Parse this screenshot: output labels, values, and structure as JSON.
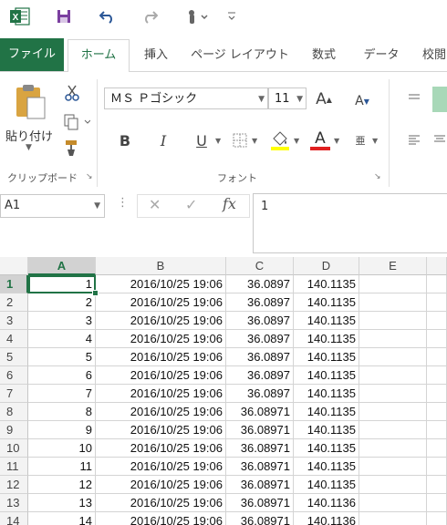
{
  "qat": {
    "excel_icon": "excel-icon",
    "save_icon": "save-icon",
    "undo_icon": "undo-icon",
    "redo_icon": "redo-icon",
    "touch_icon": "touch-mode-icon",
    "customize_icon": "customize-qat-icon"
  },
  "tabs": [
    "ファイル",
    "ホーム",
    "挿入",
    "ページ レイアウト",
    "数式",
    "データ",
    "校閲"
  ],
  "ribbon": {
    "paste_label": "貼り付け",
    "clipboard_group": "クリップボード",
    "font_group": "フォント",
    "font_name": "ＭＳ Ｐゴシック",
    "font_size": "11",
    "bold": "B",
    "italic": "I",
    "underline": "U",
    "font_color_letter": "A",
    "grow_font": "A",
    "shrink_font": "A",
    "phonetic": "亜",
    "fx": "fx"
  },
  "formula_bar": {
    "name_box": "A1",
    "formula": "1"
  },
  "grid": {
    "columns": [
      "A",
      "B",
      "C",
      "D",
      "E"
    ],
    "rows": [
      {
        "n": "1",
        "a": "1",
        "b": "2016/10/25 19:06",
        "c": "36.0897",
        "d": "140.1135"
      },
      {
        "n": "2",
        "a": "2",
        "b": "2016/10/25 19:06",
        "c": "36.0897",
        "d": "140.1135"
      },
      {
        "n": "3",
        "a": "3",
        "b": "2016/10/25 19:06",
        "c": "36.0897",
        "d": "140.1135"
      },
      {
        "n": "4",
        "a": "4",
        "b": "2016/10/25 19:06",
        "c": "36.0897",
        "d": "140.1135"
      },
      {
        "n": "5",
        "a": "5",
        "b": "2016/10/25 19:06",
        "c": "36.0897",
        "d": "140.1135"
      },
      {
        "n": "6",
        "a": "6",
        "b": "2016/10/25 19:06",
        "c": "36.0897",
        "d": "140.1135"
      },
      {
        "n": "7",
        "a": "7",
        "b": "2016/10/25 19:06",
        "c": "36.0897",
        "d": "140.1135"
      },
      {
        "n": "8",
        "a": "8",
        "b": "2016/10/25 19:06",
        "c": "36.08971",
        "d": "140.1135"
      },
      {
        "n": "9",
        "a": "9",
        "b": "2016/10/25 19:06",
        "c": "36.08971",
        "d": "140.1135"
      },
      {
        "n": "10",
        "a": "10",
        "b": "2016/10/25 19:06",
        "c": "36.08971",
        "d": "140.1135"
      },
      {
        "n": "11",
        "a": "11",
        "b": "2016/10/25 19:06",
        "c": "36.08971",
        "d": "140.1135"
      },
      {
        "n": "12",
        "a": "12",
        "b": "2016/10/25 19:06",
        "c": "36.08971",
        "d": "140.1135"
      },
      {
        "n": "13",
        "a": "13",
        "b": "2016/10/25 19:06",
        "c": "36.08971",
        "d": "140.1136"
      },
      {
        "n": "14",
        "a": "14",
        "b": "2016/10/25 19:06",
        "c": "36.08971",
        "d": "140.1136"
      }
    ]
  },
  "colors": {
    "excel_green": "#217346",
    "highlight_yellow": "#ffff00",
    "font_red": "#e02020"
  }
}
